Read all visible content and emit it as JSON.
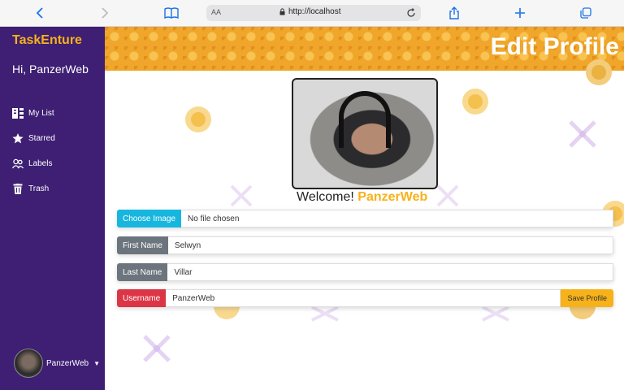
{
  "browser": {
    "text_size_label": "AA",
    "url": "http://localhost"
  },
  "sidebar": {
    "brand": "TaskEnture",
    "greeting": "Hi, PanzerWeb",
    "items": [
      {
        "label": "My List",
        "icon": "list-icon"
      },
      {
        "label": "Starred",
        "icon": "star-icon"
      },
      {
        "label": "Labels",
        "icon": "labels-icon"
      },
      {
        "label": "Trash",
        "icon": "trash-icon"
      }
    ],
    "user_name": "PanzerWeb"
  },
  "header": {
    "title": "Edit Profile"
  },
  "main": {
    "welcome_prefix": "Welcome!",
    "welcome_name": "PanzerWeb"
  },
  "form": {
    "choose_image_label": "Choose Image",
    "file_status": "No file chosen",
    "first_name_label": "First Name",
    "first_name_value": "Selwyn",
    "last_name_label": "Last Name",
    "last_name_value": "Villar",
    "username_label": "Username",
    "username_value": "PanzerWeb",
    "save_label": "Save Profile"
  },
  "colors": {
    "sidebar_bg": "#3e1f74",
    "brand_accent": "#f7b21a",
    "choose_image": "#17b6de",
    "name_label": "#6c757d",
    "username_label": "#dc3545",
    "save_button": "#f7b21a"
  }
}
